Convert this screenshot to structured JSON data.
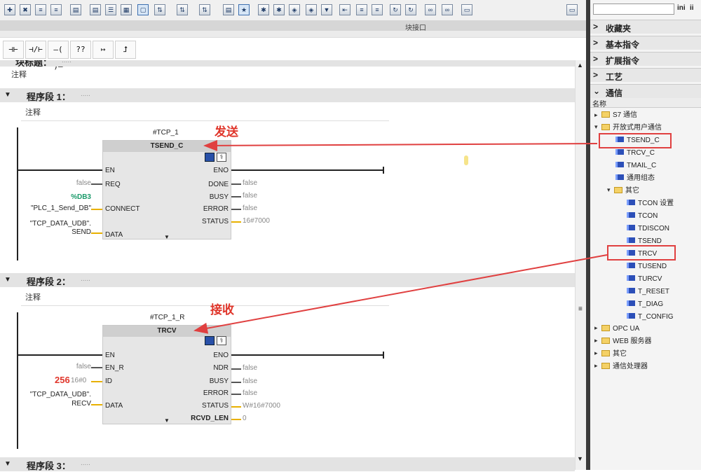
{
  "toolbar": {
    "icons": [
      "local-var-icon",
      "del-icon",
      "indent-icon",
      "outdent-icon",
      "insert-row-icon",
      "page-icon",
      "list-icon",
      "network-icon",
      "comment-icon",
      "sort-icon",
      "expand-icon",
      "collapse-icon",
      "absolute-icon",
      "favorites-icon",
      "toggle-icon",
      "error-icon",
      "tag-icon",
      "pin-icon",
      "download-icon",
      "compare-icon",
      "sync-icon",
      "monitor-icon",
      "glasses-icon"
    ]
  },
  "interface": {
    "label": "块接口"
  },
  "ladder": {
    "items": [
      "⊣⊢",
      "⊣/⊢",
      "–( )–",
      "??",
      "↦",
      "⮥"
    ]
  },
  "block_title": {
    "label": "块标题：",
    "comment": "注释"
  },
  "net1": {
    "title": "程序段 1：",
    "dots": ".....",
    "comment": "注释",
    "instance": "#TCP_1",
    "fb": "TSEND_C",
    "annotation": "发送",
    "left_pins": [
      "EN",
      "REQ",
      "CONNECT",
      "DATA"
    ],
    "right_pins": [
      "ENO",
      "DONE",
      "BUSY",
      "ERROR",
      "STATUS"
    ],
    "in_vals": {
      "req": "false",
      "connect_addr": "%DB3",
      "connect": "\"PLC_1_Send_DB\"",
      "data1": "\"TCP_DATA_UDB\".",
      "data2": "SEND"
    },
    "out_vals": {
      "done": "false",
      "busy": "false",
      "error": "false",
      "status": "16#7000"
    }
  },
  "net2": {
    "title": "程序段 2：",
    "dots": ".....",
    "comment": "注释",
    "instance": "#TCP_1_R",
    "fb": "TRCV",
    "annotation": "接收",
    "left_pins": [
      "EN",
      "EN_R",
      "ID",
      "DATA"
    ],
    "right_pins": [
      "ENO",
      "NDR",
      "BUSY",
      "ERROR",
      "STATUS",
      "RCVD_LEN"
    ],
    "in_vals": {
      "en_r": "false",
      "id_big": "256",
      "id_small": "16#0",
      "data1": "\"TCP_DATA_UDB\".",
      "data2": "RECV"
    },
    "out_vals": {
      "ndr": "false",
      "busy": "false",
      "error": "false",
      "status": "W#16#7000",
      "rcvd_len": "0"
    }
  },
  "net3": {
    "title": "程序段 3：",
    "dots": "....."
  },
  "right_panel": {
    "search_placeholder": "",
    "categories": [
      "收藏夹",
      "基本指令",
      "扩展指令",
      "工艺",
      "通信"
    ],
    "column_header": "名称",
    "tree": [
      "S7 通信",
      "开放式用户通信",
      "TSEND_C",
      "TRCV_C",
      "TMAIL_C",
      "通用组态",
      "其它",
      "TCON 设置",
      "TCON",
      "TDISCON",
      "TSEND",
      "TRCV",
      "TUSEND",
      "TURCV",
      "T_RESET",
      "T_DIAG",
      "T_CONFIG",
      "OPC UA",
      "WEB 服务器",
      "其它",
      "通信处理器"
    ]
  },
  "colors": {
    "annotation": "#e0362b",
    "block_icon": "#2c4fb8",
    "folder": "#f4d166"
  }
}
